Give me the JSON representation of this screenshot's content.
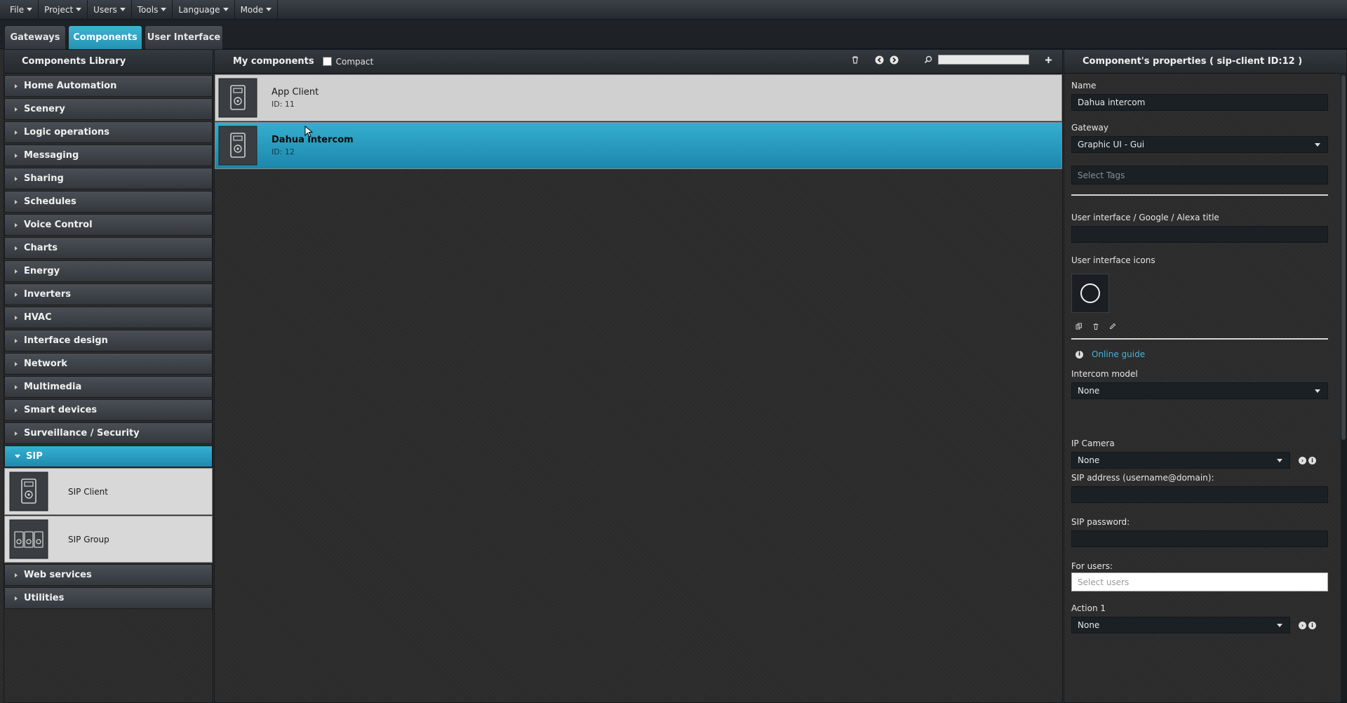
{
  "menubar": {
    "items": [
      "File",
      "Project",
      "Users",
      "Tools",
      "Language",
      "Mode"
    ]
  },
  "tabs": {
    "gateways": "Gateways",
    "components": "Components",
    "user_interface": "User Interface"
  },
  "library": {
    "title": "Components Library",
    "categories": [
      "Home Automation",
      "Scenery",
      "Logic operations",
      "Messaging",
      "Sharing",
      "Schedules",
      "Voice Control",
      "Charts",
      "Energy",
      "Inverters",
      "HVAC",
      "Interface design",
      "Network",
      "Multimedia",
      "Smart devices",
      "Surveillance / Security"
    ],
    "active_category": "SIP",
    "sip_items": [
      "SIP Client",
      "SIP Group"
    ],
    "after_categories": [
      "Web services",
      "Utilities"
    ]
  },
  "my_components": {
    "title": "My components",
    "compact_label": "Compact",
    "items": [
      {
        "name": "App Client",
        "id": "ID: 11"
      },
      {
        "name": "Dahua intercom",
        "id": "ID: 12"
      }
    ]
  },
  "properties": {
    "title": "Component's properties ( sip-client ID:12 )",
    "name_label": "Name",
    "name_value": "Dahua intercom",
    "gateway_label": "Gateway",
    "gateway_value": "Graphic UI - Gui",
    "tags_placeholder": "Select Tags",
    "ui_title_label": "User interface / Google / Alexa title",
    "ui_icons_label": "User interface icons",
    "online_guide": "Online guide",
    "intercom_model_label": "Intercom model",
    "intercom_model_value": "None",
    "ip_camera_label": "IP Camera",
    "ip_camera_value": "None",
    "sip_address_label": "SIP address (username@domain):",
    "sip_password_label": "SIP password:",
    "for_users_label": "For users:",
    "users_placeholder": "Select users",
    "action1_label": "Action 1",
    "action1_value": "None"
  },
  "colors": {
    "accent": "#2a9ec2",
    "panel_bg": "#2a2a2a",
    "link": "#42b4dd"
  }
}
